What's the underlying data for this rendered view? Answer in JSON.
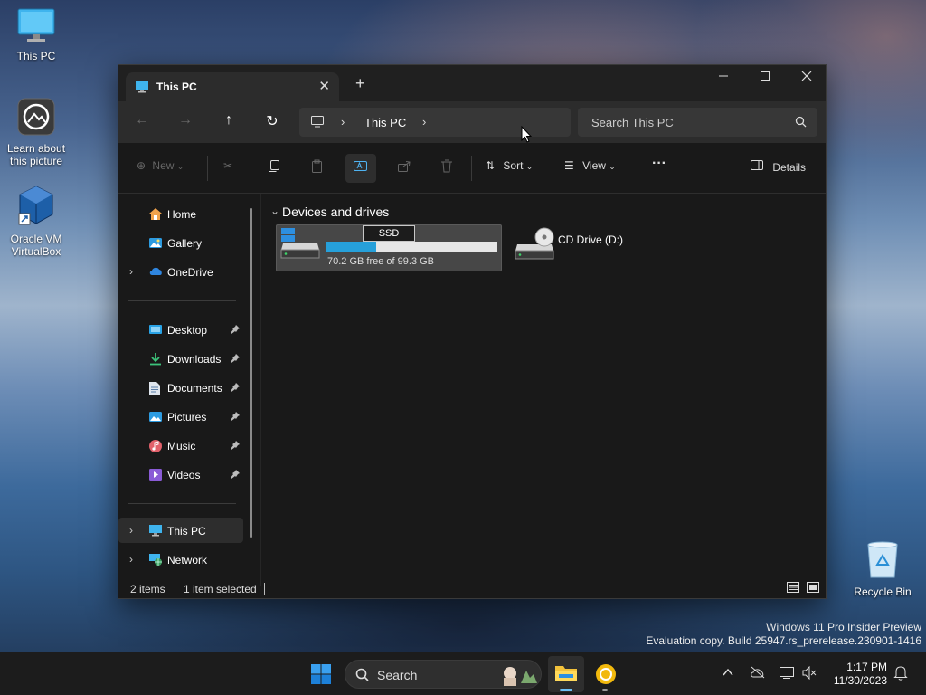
{
  "desktop": {
    "icons": [
      {
        "label": "This PC",
        "icon": "monitor-icon"
      },
      {
        "label": "Learn about this picture",
        "icon": "camera-icon"
      },
      {
        "label": "Oracle VM VirtualBox",
        "icon": "virtualbox-icon"
      }
    ],
    "recycle_bin": "Recycle Bin",
    "watermark_line1": "Windows 11 Pro Insider Preview",
    "watermark_line2": "Evaluation copy. Build 25947.rs_prerelease.230901-1416"
  },
  "window": {
    "tab_title": "This PC",
    "address": {
      "crumb": "This PC"
    },
    "search_placeholder": "Search This PC",
    "toolbar": {
      "new_label": "New",
      "sort_label": "Sort",
      "view_label": "View",
      "details_label": "Details"
    },
    "sidebar": {
      "quick": [
        {
          "label": "Home",
          "icon": "home-icon"
        },
        {
          "label": "Gallery",
          "icon": "gallery-icon"
        },
        {
          "label": "OneDrive",
          "icon": "cloud-icon"
        }
      ],
      "pinned": [
        {
          "label": "Desktop",
          "icon": "desktop-folder-icon"
        },
        {
          "label": "Downloads",
          "icon": "download-icon"
        },
        {
          "label": "Documents",
          "icon": "document-icon"
        },
        {
          "label": "Pictures",
          "icon": "pictures-icon"
        },
        {
          "label": "Music",
          "icon": "music-icon"
        },
        {
          "label": "Videos",
          "icon": "video-icon"
        }
      ],
      "locations": [
        {
          "label": "This PC",
          "icon": "monitor-icon",
          "selected": true
        },
        {
          "label": "Network",
          "icon": "network-icon"
        }
      ]
    },
    "content": {
      "group_title": "Devices and drives",
      "drives": [
        {
          "free_text": "70.2 GB free of 99.3 GB",
          "used_fraction": 0.29,
          "tooltip": "SSD"
        },
        {
          "label": "CD Drive (D:)"
        }
      ]
    },
    "status": {
      "items": "2 items",
      "selected": "1 item selected"
    }
  },
  "taskbar": {
    "search_placeholder": "Search",
    "time": "1:17 PM",
    "date": "11/30/2023"
  },
  "colors": {
    "accent": "#26a0da",
    "window_bg": "#191919",
    "taskbar_bg": "#1c1c1c"
  }
}
